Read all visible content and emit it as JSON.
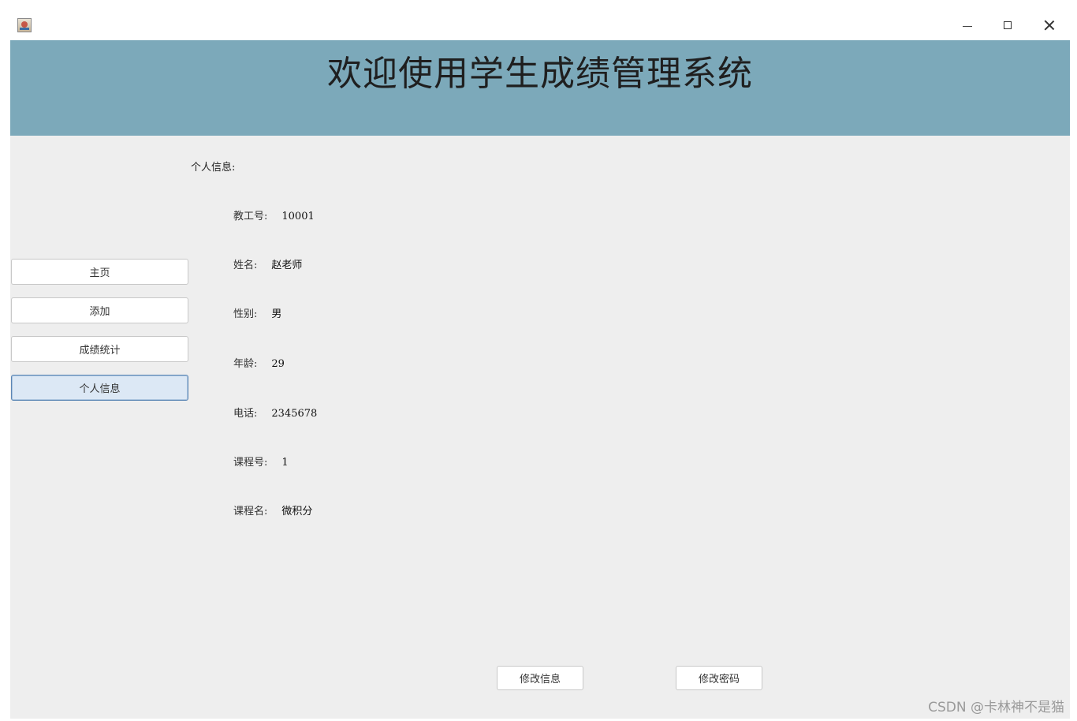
{
  "window": {
    "icon": "java-app-icon",
    "controls": {
      "minimize_icon": "minimize-icon",
      "maximize_icon": "maximize-icon",
      "close_icon": "close-icon"
    }
  },
  "header": {
    "title": "欢迎使用学生成绩管理系统",
    "background": "#7ca9ba"
  },
  "sidebar": {
    "items": [
      {
        "label": "主页",
        "active": false
      },
      {
        "label": "添加",
        "active": false
      },
      {
        "label": "成绩统计",
        "active": false
      },
      {
        "label": "个人信息",
        "active": true
      }
    ]
  },
  "profile": {
    "section_label": "个人信息:",
    "fields": [
      {
        "label": "教工号:",
        "value": "10001"
      },
      {
        "label": "姓名:",
        "value": "赵老师"
      },
      {
        "label": "性别:",
        "value": "男"
      },
      {
        "label": "年龄:",
        "value": "29"
      },
      {
        "label": "电话:",
        "value": "2345678"
      },
      {
        "label": "课程号:",
        "value": "1"
      },
      {
        "label": "课程名:",
        "value": "微积分"
      }
    ]
  },
  "actions": {
    "edit_info_label": "修改信息",
    "change_password_label": "修改密码"
  },
  "watermark": "CSDN @卡林神不是猫"
}
